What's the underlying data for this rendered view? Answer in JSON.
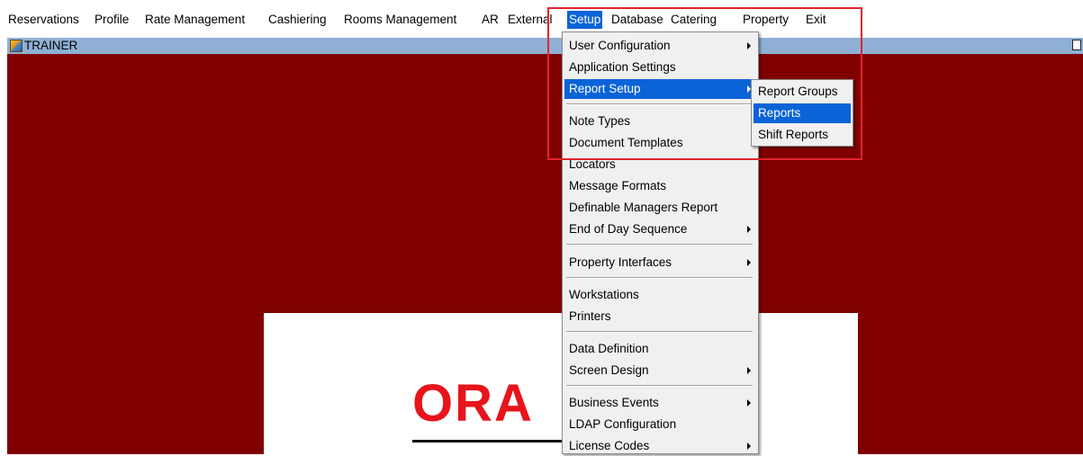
{
  "menubar": {
    "items": [
      {
        "label": "Reservations"
      },
      {
        "label": "Profile"
      },
      {
        "label": "Rate Management"
      },
      {
        "label": "Cashiering"
      },
      {
        "label": "Rooms Management"
      },
      {
        "label": "AR"
      },
      {
        "label": "External"
      },
      {
        "label": "Setup"
      },
      {
        "label": "Database"
      },
      {
        "label": "Catering"
      },
      {
        "label": "Property"
      },
      {
        "label": "Exit"
      }
    ]
  },
  "window": {
    "title": "TRAINER"
  },
  "splash": {
    "logo_text": "ORA"
  },
  "setup_menu": {
    "items": [
      {
        "label": "User Configuration"
      },
      {
        "label": "Application Settings"
      },
      {
        "label": "Report Setup"
      },
      {
        "label": "Note Types"
      },
      {
        "label": "Document Templates"
      },
      {
        "label": "Locators"
      },
      {
        "label": "Message Formats"
      },
      {
        "label": "Definable Managers Report"
      },
      {
        "label": "End of Day Sequence"
      },
      {
        "label": "Property Interfaces"
      },
      {
        "label": "Workstations"
      },
      {
        "label": "Printers"
      },
      {
        "label": "Data Definition"
      },
      {
        "label": "Screen Design"
      },
      {
        "label": "Business Events"
      },
      {
        "label": "LDAP Configuration"
      },
      {
        "label": "License Codes"
      }
    ]
  },
  "report_setup_submenu": {
    "items": [
      {
        "label": "Report Groups"
      },
      {
        "label": "Reports"
      },
      {
        "label": "Shift Reports"
      }
    ]
  },
  "colors": {
    "workspace": "#800000",
    "selection": "#0a64d8",
    "titlebar": "#8fb0d4",
    "annotation": "#e2242c",
    "logo": "#e8141c"
  }
}
